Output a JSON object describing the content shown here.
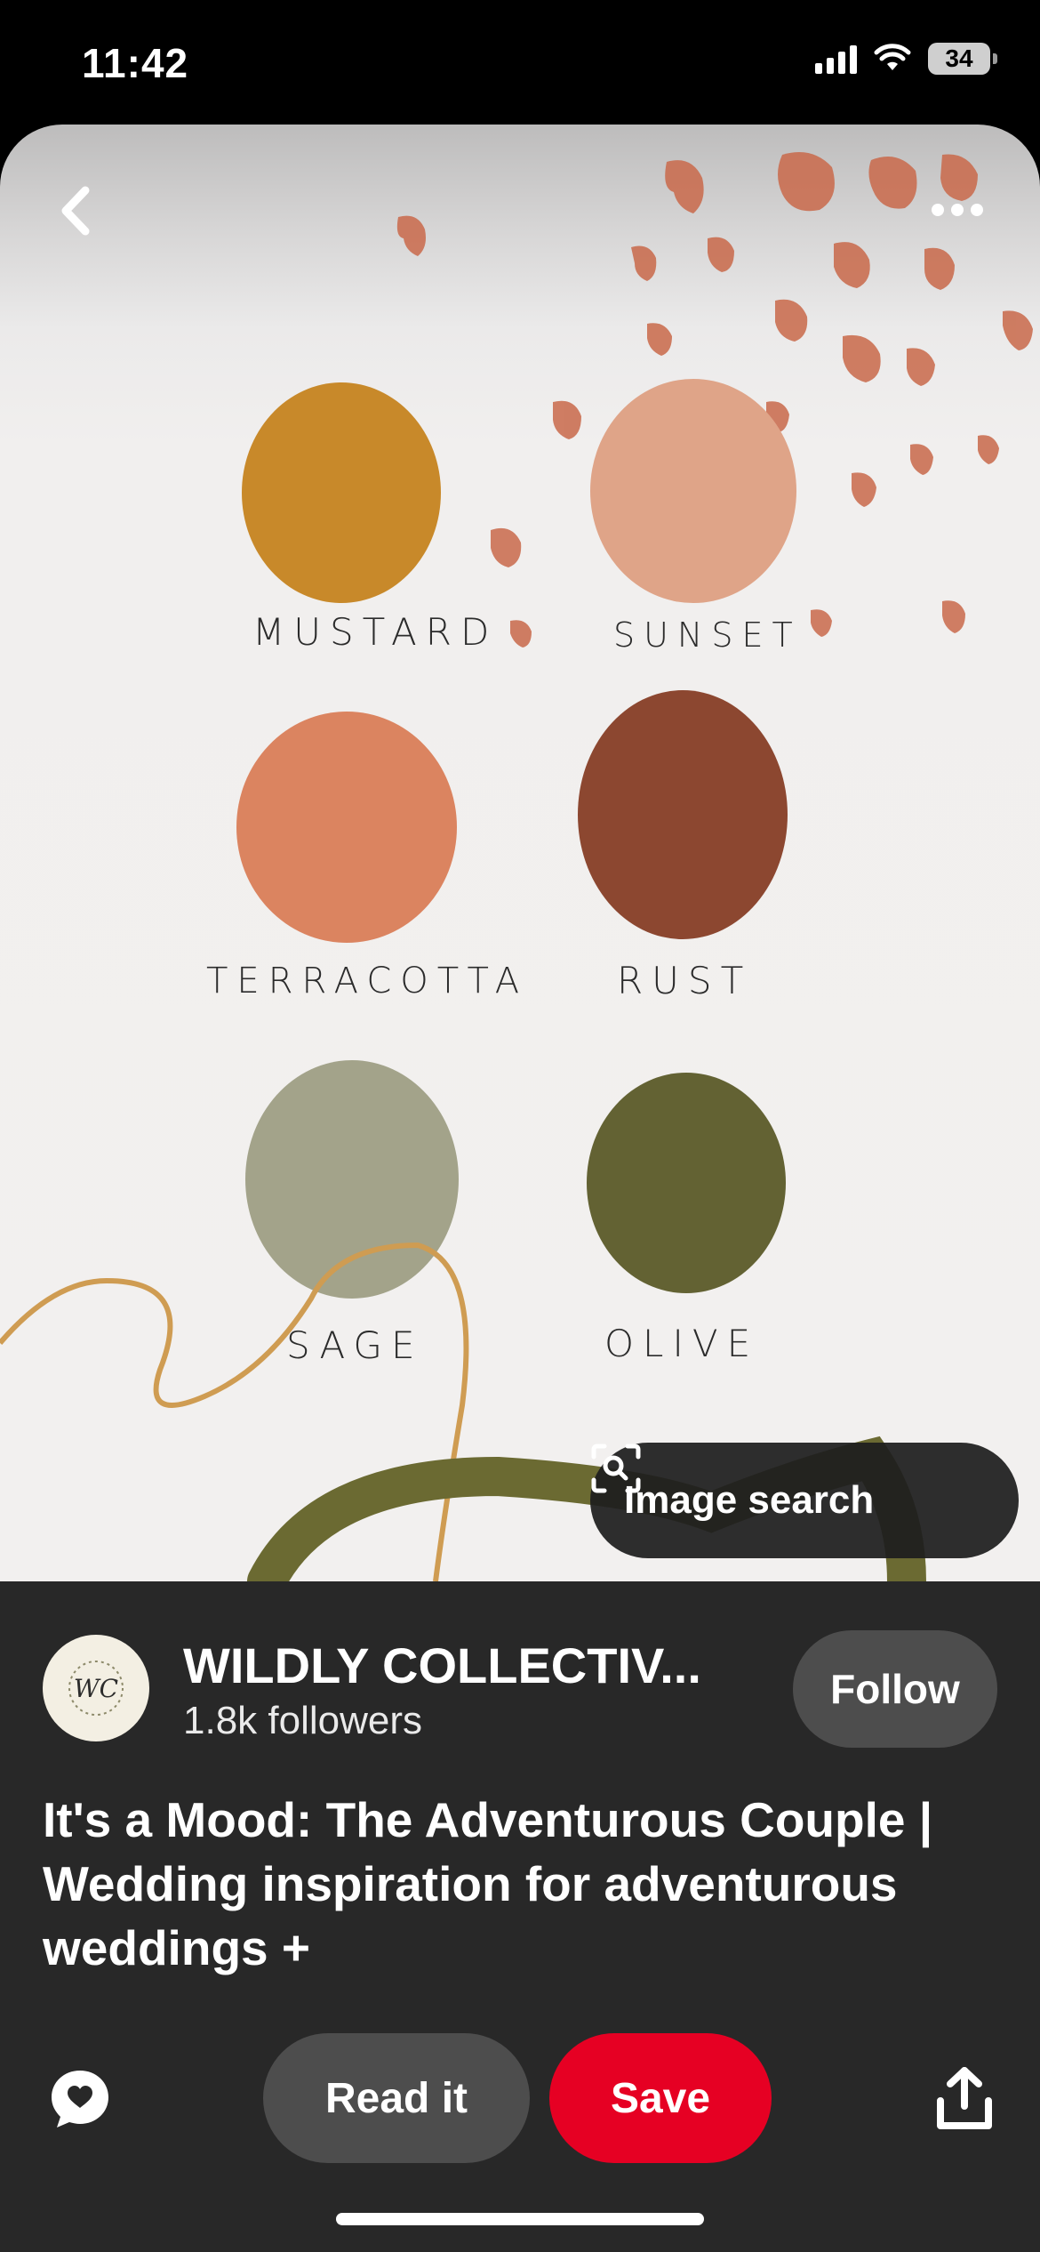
{
  "status_bar": {
    "time": "11:42",
    "battery": "34"
  },
  "pin_image": {
    "swatches": [
      {
        "label": "MUSTARD",
        "color": "#c8892a"
      },
      {
        "label": "SUNSET",
        "color": "#dfa488"
      },
      {
        "label": "TERRACOTTA",
        "color": "#db8460"
      },
      {
        "label": "RUST",
        "color": "#8c4730"
      },
      {
        "label": "SAGE",
        "color": "#a3a38a"
      },
      {
        "label": "OLIVE",
        "color": "#636233"
      }
    ],
    "accent_colors": {
      "petals": "#c9694a",
      "thread": "#cf9c52",
      "olive_stroke": "#6b6a32"
    }
  },
  "image_search": {
    "label": "Image search"
  },
  "creator": {
    "name": "WILDLY COLLECTIV...",
    "followers": "1.8k followers",
    "avatar_text": "WC",
    "follow_label": "Follow"
  },
  "pin": {
    "title": "It's a Mood: The Adventurous Couple | Wedding inspiration for adventurous weddings +"
  },
  "actions": {
    "read_label": "Read it",
    "save_label": "Save"
  },
  "colors": {
    "save_red": "#e60023",
    "panel_bg": "#282828",
    "button_gray": "#4d4d4d"
  }
}
